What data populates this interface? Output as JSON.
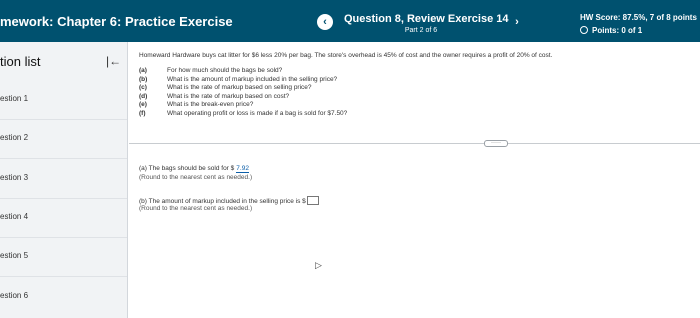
{
  "header": {
    "hw_title": "mework:  Chapter 6: Practice Exercise",
    "prev_label": "‹",
    "question_title": "Question 8, Review Exercise 14",
    "question_part": "Part 2 of 6",
    "next_label": "›",
    "hw_score": "HW Score: 87.5%, 7 of 8 points",
    "points": "Points: 0 of 1"
  },
  "sidebar": {
    "title": "tion list",
    "collapse_icon": "|←",
    "items": [
      {
        "label": "estion 1"
      },
      {
        "label": "estion 2"
      },
      {
        "label": "estion 3"
      },
      {
        "label": "estion 4"
      },
      {
        "label": "estion 5"
      },
      {
        "label": "estion 6"
      }
    ]
  },
  "question": {
    "intro": "Homeward Hardware buys cat litter for $6 less 20% per bag. The store's overhead is 45% of cost and the owner requires a profit of 20% of cost.",
    "parts": [
      {
        "letter": "(a)",
        "text": "For how much should the bags be sold?"
      },
      {
        "letter": "(b)",
        "text": "What is the amount of markup included in the selling price?"
      },
      {
        "letter": "(c)",
        "text": "What is the rate of markup based on selling price?"
      },
      {
        "letter": "(d)",
        "text": "What is the rate of markup based on cost?"
      },
      {
        "letter": "(e)",
        "text": "What is the break-even price?"
      },
      {
        "letter": "(f)",
        "text": "What operating profit or loss is made if a bag is sold for $7.50?"
      }
    ],
    "more_label": "·····"
  },
  "answers": {
    "a_text": "(a) The bags should be sold for $",
    "a_value": "7.92",
    "a_hint": "(Round to the nearest cent as needed.)",
    "b_text": "(b) The amount of markup included in the selling price is $",
    "b_value": "",
    "b_hint": "(Round to the nearest cent as needed.)"
  }
}
